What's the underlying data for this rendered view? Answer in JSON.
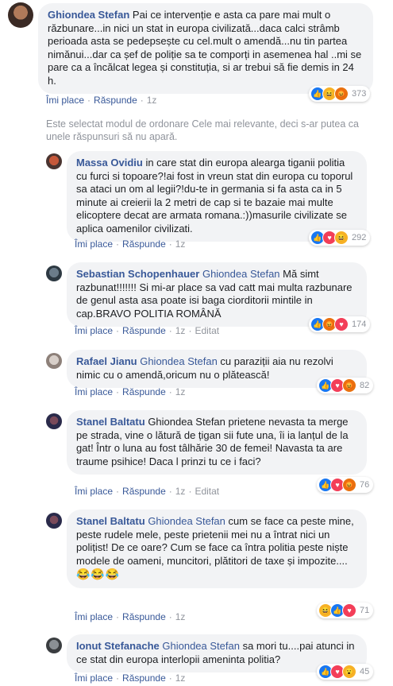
{
  "notice": "Este selectat modul de ordonare Cele mai relevante, deci s-ar putea ca unele răspunsuri să nu apară.",
  "common": {
    "like": "Îmi place",
    "reply": "Răspunde",
    "sep": "·",
    "edited": "Editat"
  },
  "comments": [
    {
      "author": "Ghiondea Stefan",
      "text": "Pai ce intervenție e asta ca pare mai mult o răzbunare...in nici un stat in europa civilizată...daca calci strâmb perioada asta se pedepsește cu cel.mult o amendă...nu tin partea nimănui...dar ca șef de poliție sa te comporți in asemenea hal ..mi se pare ca a încălcat legea și constituția, si ar trebui să fie demis in 24 h.",
      "time": "1z",
      "count": "373",
      "reactions": [
        "like",
        "haha",
        "angry"
      ]
    },
    {
      "author": "Massa Ovidiu",
      "text": "in care stat din europa alearga tiganii politia cu furci si topoare?!ai fost in vreun stat din europa cu toporul sa ataci un om al legii?!du-te in germania si fa asta ca in 5 minute ai creierii la 2 metri de cap si te bazaie mai multe elicoptere decat are armata romana.:))masurile civilizate se aplica oamenilor civilizati.",
      "time": "1z",
      "count": "292",
      "reactions": [
        "like",
        "love",
        "haha"
      ]
    },
    {
      "author": "Sebastian Schopenhauer",
      "mention": "Ghiondea Stefan",
      "text": "Mă simt razbunat!!!!!!! Si mi-ar place sa vad catt mai multa razbunare de genul asta asa poate isi baga ciorditorii mintile in cap.BRAVO POLITIA ROMÂNĂ",
      "time": "1z",
      "edited": true,
      "count": "174",
      "reactions": [
        "like",
        "angry",
        "love"
      ]
    },
    {
      "author": "Rafael Jianu",
      "mention": "Ghiondea Stefan",
      "text": "cu paraziții aia nu rezolvi nimic cu o amendă,oricum nu o plătească!",
      "time": "1z",
      "count": "82",
      "reactions": [
        "like",
        "love",
        "angry"
      ]
    },
    {
      "author": "Stanel Baltatu",
      "text": "Ghiondea Stefan prietene nevasta ta merge pe strada, vine o lătură de țigan sii fute una, îi ia lanțul de la gat! Într o luna au fost tâlhărie 30 de femei! Navasta ta are traume psihice! Daca l prinzi tu ce i faci?",
      "time": "1z",
      "edited": true,
      "count": "76",
      "reactions": [
        "like",
        "love",
        "angry"
      ]
    },
    {
      "author": "Stanel Baltatu",
      "mention": "Ghiondea Stefan",
      "text": "cum se face ca peste mine, peste rudele mele, peste prietenii mei nu a întrat nici un polițist! De ce oare? Cum se face ca întra politia peste niște modele de oameni, muncitori, plătitori de taxe și impozite....",
      "emojis": "😂😂😂",
      "time": "1z",
      "count": "71",
      "reactions": [
        "haha",
        "like",
        "love"
      ]
    },
    {
      "author": "Ionut Stefanache",
      "mention": "Ghiondea Stefan",
      "text": "sa mori tu....pai atunci in ce stat din europa interlopii ameninta politia?",
      "time": "1z",
      "count": "45",
      "reactions": [
        "like",
        "love",
        "wow"
      ]
    }
  ]
}
